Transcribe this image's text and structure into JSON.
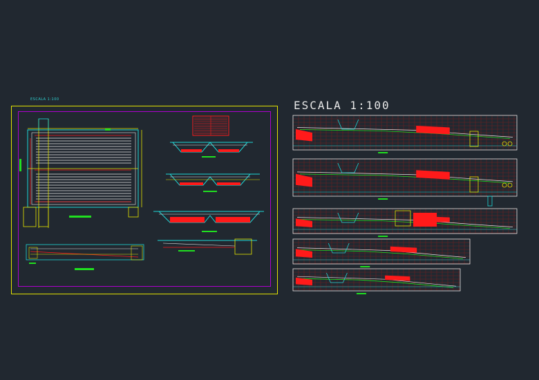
{
  "drawing": {
    "scale_label_small": "ESCALA 1:100",
    "scale_label_large": "ESCALA 1:100"
  },
  "colors": {
    "background": "#212830",
    "sheet_border": "#e6e600",
    "inner_border": "#b000d0",
    "cyan": "#20d8d8",
    "red": "#ff1a1a",
    "green": "#20e020",
    "white": "#e8e8e8",
    "yellow": "#e6e600",
    "grid": "#c02020"
  }
}
